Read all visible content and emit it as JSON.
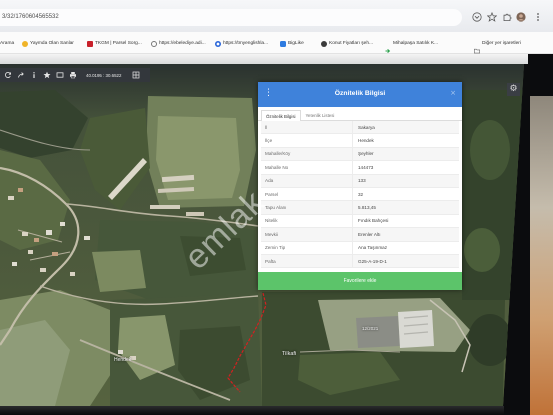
{
  "browser": {
    "address": "3/32/1760604565532",
    "toolbar_icons": [
      "chevron-down-icon",
      "star-icon",
      "extensions-icon",
      "profile-avatar",
      "more-menu-icon"
    ],
    "bookmarks": [
      {
        "label": "Arama",
        "icon": "page-icon"
      },
      {
        "label": "Yaymda Olan Sanlar",
        "icon": "site-icon"
      },
      {
        "label": "TKGM | Parsel Sorg...",
        "icon": "tkgm-icon"
      },
      {
        "label": "https://ebelediye.adi...",
        "icon": "globe-icon"
      },
      {
        "label": "https://tmyenglishla...",
        "icon": "site-icon"
      },
      {
        "label": "BigLike",
        "icon": "site-icon"
      },
      {
        "label": "Konut Fiyatları şeh...",
        "icon": "site-icon"
      },
      {
        "label": "Mihalpaşa Satılık K...",
        "icon": "arrow-icon"
      }
    ],
    "other_bookmarks": "Diğer yer işaretleri"
  },
  "map": {
    "tool_icons": [
      "refresh-icon",
      "share-icon",
      "info-icon",
      "star-icon",
      "layers-icon",
      "print-icon",
      "grid-icon"
    ],
    "coordinates": "40.0195 : 30.6522",
    "settings_icon": "gear-icon",
    "labels": {
      "town": "Hendek",
      "area": "Tilkafi",
      "parcel": "12/2021"
    }
  },
  "popup": {
    "title": "Öznitelik Bilgisi",
    "tabs": [
      {
        "label": "Öznitelik Bilgisi",
        "active": true
      },
      {
        "label": "Yetenlik Listesi",
        "active": false
      }
    ],
    "rows": [
      {
        "label": "İl",
        "value": "Sakarya"
      },
      {
        "label": "İlçe",
        "value": "Hendek"
      },
      {
        "label": "Mahalle/Köy",
        "value": "Şeyhler"
      },
      {
        "label": "Mahalle No",
        "value": "144473"
      },
      {
        "label": "Ada",
        "value": "133"
      },
      {
        "label": "Parsel",
        "value": "32"
      },
      {
        "label": "Tapu Alanı",
        "value": "5.813,45"
      },
      {
        "label": "Nitelik",
        "value": "Fındık Bahçesi"
      },
      {
        "label": "Mevkii",
        "value": "Erenler Altı"
      },
      {
        "label": "Zemin Tip",
        "value": "Ana Taşınmaz"
      },
      {
        "label": "Pafta",
        "value": "G25-A-19-D-1"
      }
    ],
    "favorite_button": "Favorilere ekle"
  },
  "watermark": "emlak",
  "colors": {
    "popup_header": "#3f82da",
    "favorite_button": "#5cc46a",
    "parcel_boundary": "#d42020"
  }
}
